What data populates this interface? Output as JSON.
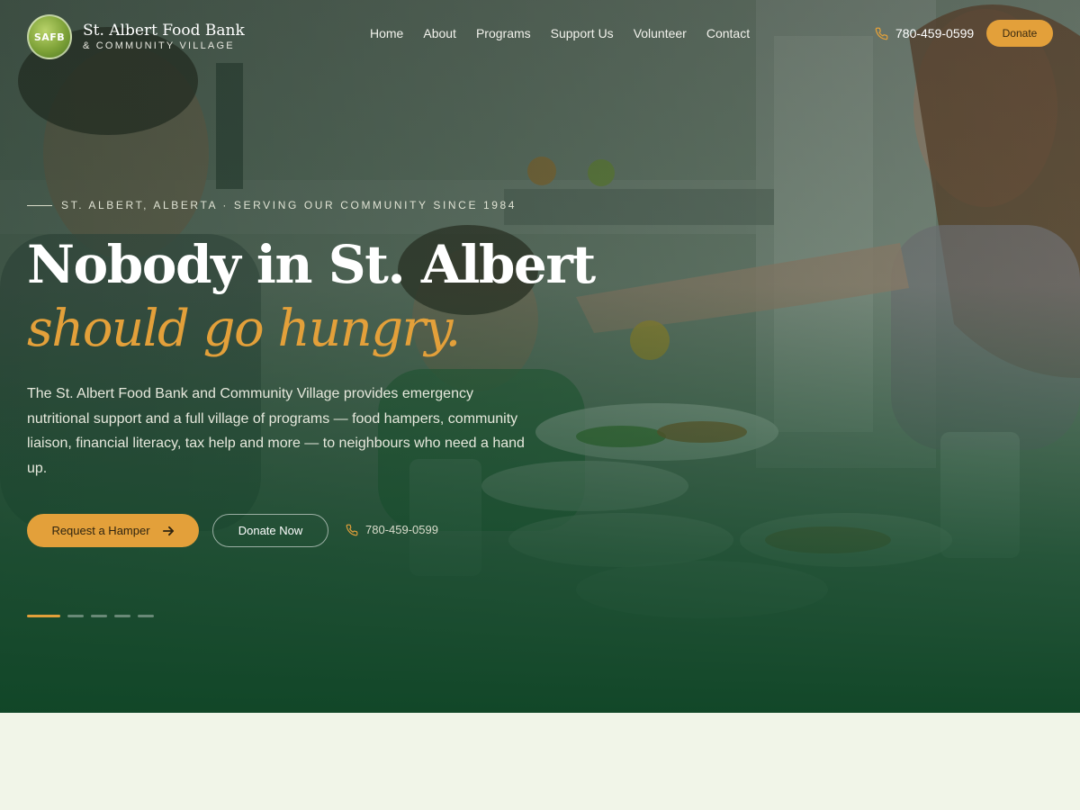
{
  "brand": {
    "logo_text": "SAFB",
    "title": "St. Albert Food Bank",
    "subtitle": "& COMMUNITY VILLAGE"
  },
  "nav": {
    "items": [
      "Home",
      "About",
      "Programs",
      "Support Us",
      "Volunteer",
      "Contact"
    ]
  },
  "header": {
    "phone": "780-459-0599",
    "donate_label": "Donate",
    "phone_icon": "phone-icon"
  },
  "hero": {
    "eyebrow": "ST. ALBERT, ALBERTA · SERVING OUR COMMUNITY SINCE 1984",
    "headline_line1": "Nobody in St. Albert",
    "headline_line2": "should go hungry.",
    "intro": "The St. Albert Food Bank and Community Village provides emergency nutritional support and a full village of programs — food hampers, community liaison, financial literacy, tax help and more — to neighbours who need a hand up.",
    "primary_button": "Request a Hamper",
    "primary_icon": "arrow-right-icon",
    "secondary_button": "Donate Now",
    "phone": "780-459-0599",
    "slides": {
      "count": 5,
      "active": 1
    }
  },
  "colors": {
    "accent": "#e3a03a",
    "hero_green": "#114828",
    "page_bg": "#f1f5e8"
  }
}
